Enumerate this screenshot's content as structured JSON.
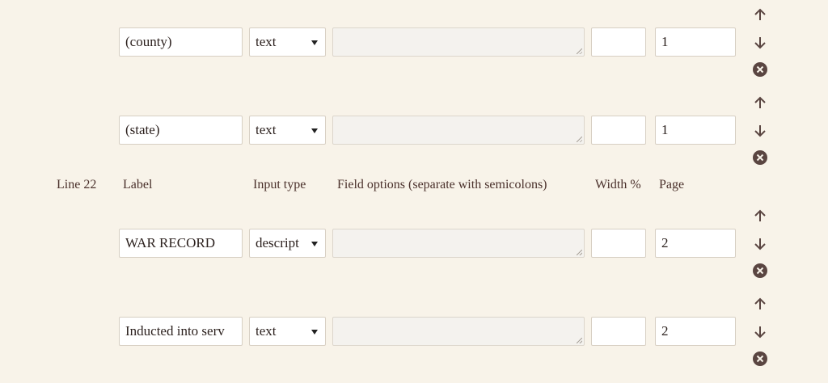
{
  "header": {
    "line": "Line 22",
    "label": "Label",
    "input_type": "Input type",
    "field_options": "Field options (separate with semicolons)",
    "width": "Width %",
    "page": "Page"
  },
  "rows": [
    {
      "label": "(county)",
      "type": "text",
      "options": "",
      "width": "",
      "page": "1"
    },
    {
      "label": "(state)",
      "type": "text",
      "options": "",
      "width": "",
      "page": "1"
    },
    {
      "label": "WAR RECORD",
      "type": "descript",
      "options": "",
      "width": "",
      "page": "2"
    },
    {
      "label": "Inducted into serv",
      "type": "text",
      "options": "",
      "width": "",
      "page": "2"
    }
  ],
  "icons": {
    "up": "arrow-up-icon",
    "down": "arrow-down-icon",
    "remove": "remove-circle-icon"
  },
  "colors": {
    "background": "#f8f3e9",
    "icon": "#5a4541",
    "text": "#3b2a26"
  }
}
